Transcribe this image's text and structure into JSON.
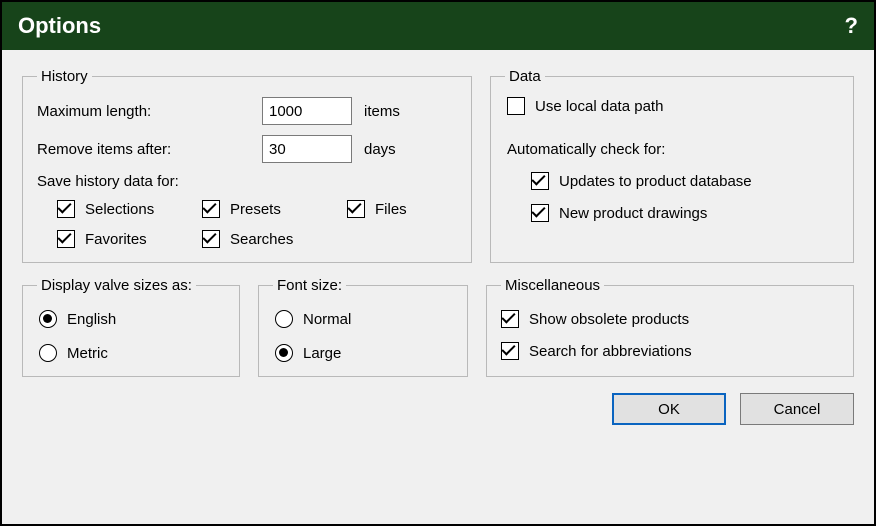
{
  "title": "Options",
  "help": "?",
  "history": {
    "legend": "History",
    "maxLengthLabel": "Maximum length:",
    "maxLengthValue": "1000",
    "maxLengthUnit": "items",
    "removeAfterLabel": "Remove items after:",
    "removeAfterValue": "30",
    "removeAfterUnit": "days",
    "saveLabel": "Save history data for:",
    "cb": {
      "selections": "Selections",
      "presets": "Presets",
      "files": "Files",
      "favorites": "Favorites",
      "searches": "Searches"
    }
  },
  "data": {
    "legend": "Data",
    "useLocal": "Use local data path",
    "autoLabel": "Automatically check for:",
    "updates": "Updates to product database",
    "drawings": "New product drawings"
  },
  "display": {
    "legend": "Display valve sizes as:",
    "english": "English",
    "metric": "Metric"
  },
  "font": {
    "legend": "Font size:",
    "normal": "Normal",
    "large": "Large"
  },
  "misc": {
    "legend": "Miscellaneous",
    "obsolete": "Show obsolete products",
    "abbrev": "Search for abbreviations"
  },
  "buttons": {
    "ok": "OK",
    "cancel": "Cancel"
  }
}
